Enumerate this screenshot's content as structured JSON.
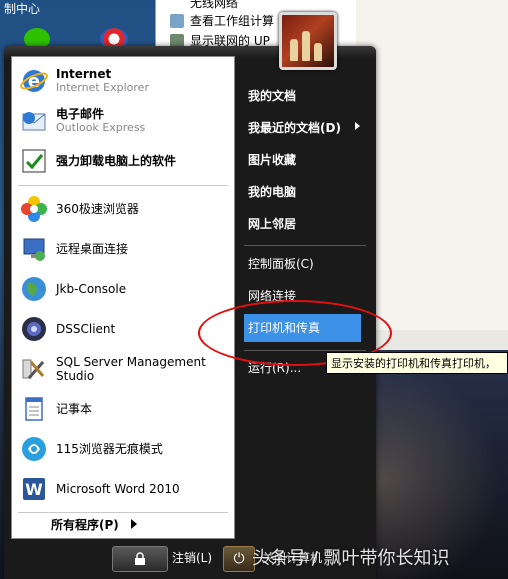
{
  "desktop": {
    "label": "制中心"
  },
  "explorer": {
    "items": [
      "无线网络",
      "查看工作组计算",
      "显示联网的 UP"
    ]
  },
  "start_menu": {
    "pinned": [
      {
        "title": "Internet",
        "subtitle": "Internet Explorer",
        "icon": "ie-icon"
      },
      {
        "title": "电子邮件",
        "subtitle": "Outlook Express",
        "icon": "outlook-icon"
      },
      {
        "title": "强力卸载电脑上的软件",
        "subtitle": "",
        "icon": "uninstall-icon"
      }
    ],
    "recent": [
      {
        "title": "360极速浏览器",
        "icon": "360-browser-icon"
      },
      {
        "title": "远程桌面连接",
        "icon": "remote-desktop-icon"
      },
      {
        "title": "Jkb-Console",
        "icon": "globe-icon"
      },
      {
        "title": "DSSClient",
        "icon": "camera-icon"
      },
      {
        "title": "SQL Server Management Studio",
        "icon": "sql-tools-icon"
      },
      {
        "title": "记事本",
        "icon": "notepad-icon"
      },
      {
        "title": "115浏览器无痕模式",
        "icon": "115-browser-icon"
      },
      {
        "title": "Microsoft Word 2010",
        "icon": "word-icon"
      }
    ],
    "all_programs": "所有程序(P)",
    "right": [
      {
        "label": "我的文档",
        "bold": true
      },
      {
        "label": "我最近的文档(D)",
        "bold": true
      },
      {
        "label": "图片收藏",
        "bold": true
      },
      {
        "label": "我的电脑",
        "bold": true
      },
      {
        "label": "网上邻居",
        "bold": true
      },
      {
        "label": "控制面板(C)",
        "bold": false
      },
      {
        "label": "网络连接",
        "bold": false
      },
      {
        "label": "打印机和传真",
        "bold": false,
        "highlighted": true
      },
      {
        "label": "运行(R)...",
        "bold": false
      }
    ],
    "tooltip": "显示安装的打印机和传真打印机，",
    "logoff": "注销(L)",
    "shutdown": "关闭计算机",
    "watermark": "头条号 / 飘叶带你长知识"
  },
  "colors": {
    "highlight": "#3c91e6",
    "annotation": "#e01010"
  }
}
